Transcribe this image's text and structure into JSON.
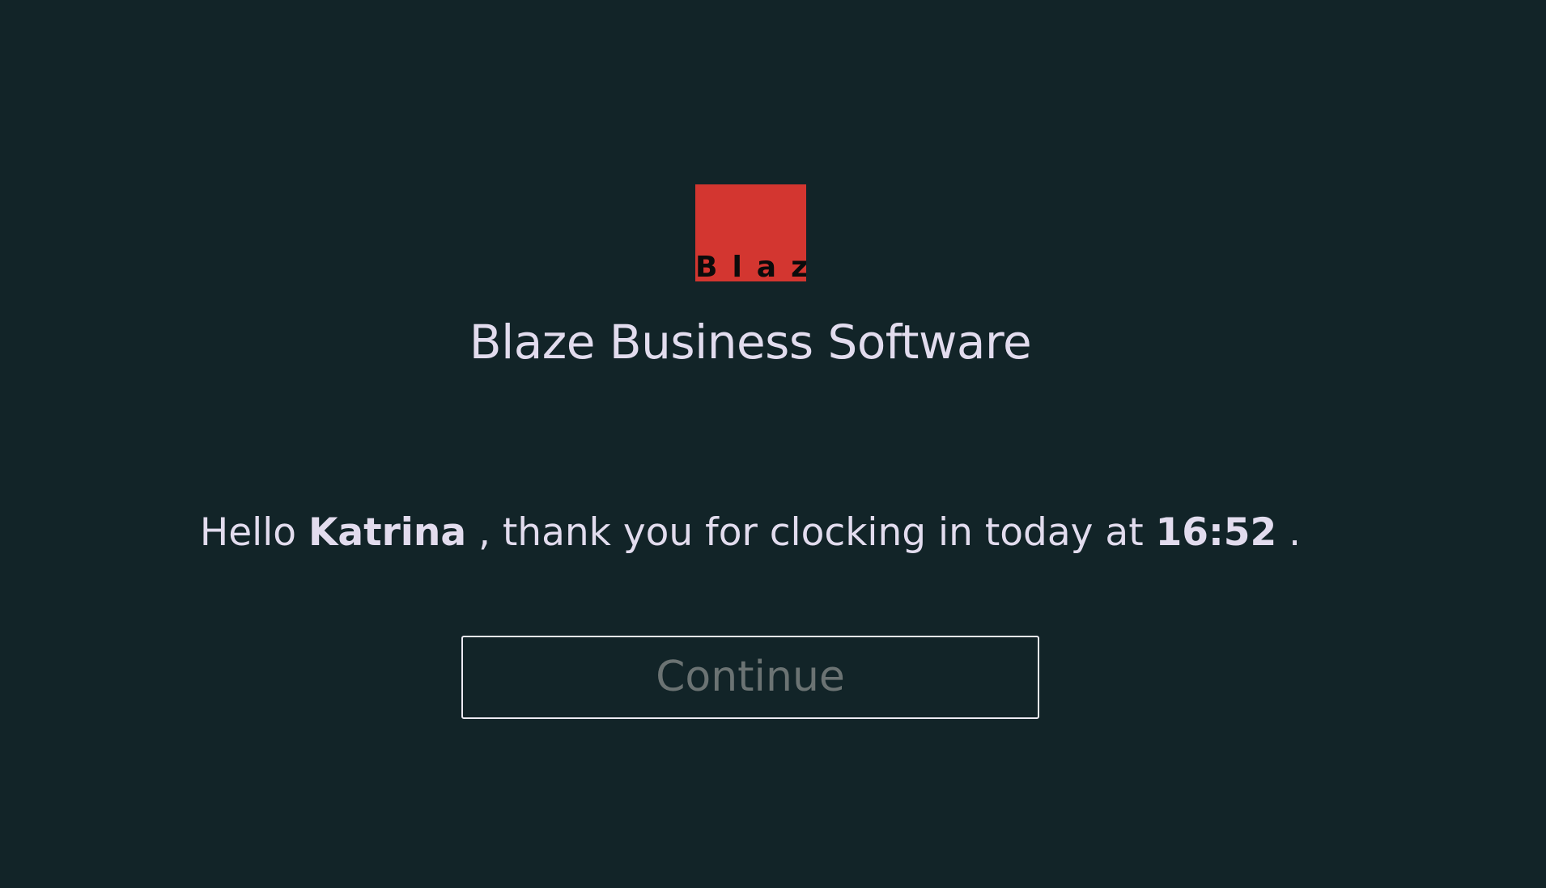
{
  "app": {
    "logo_text": "Blaze",
    "title": "Blaze Business Software"
  },
  "greeting": {
    "prefix": "Hello",
    "name": "Katrina",
    "middle": ", thank you for clocking in today at",
    "time": "16:52",
    "suffix": "."
  },
  "actions": {
    "continue_label": "Continue"
  },
  "colors": {
    "background": "#122428",
    "logo_red": "#d33630",
    "text": "#e2dcee",
    "button_text": "#6b7373",
    "button_border": "#eceaf2"
  }
}
